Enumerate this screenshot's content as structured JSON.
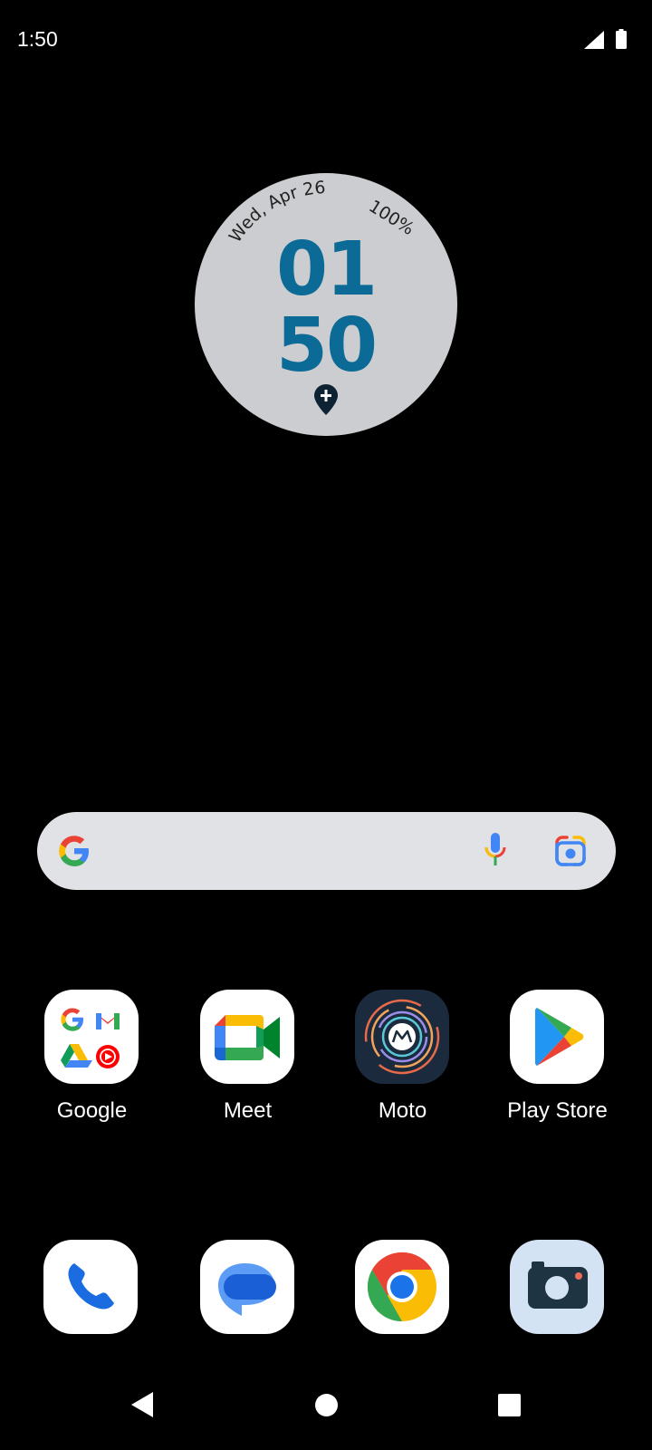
{
  "status_bar": {
    "time": "1:50",
    "icons": [
      "signal-icon",
      "battery-icon"
    ]
  },
  "clock_widget": {
    "date": "Wed, Apr 26",
    "battery": "100%",
    "hours": "01",
    "minutes": "50",
    "accent_color": "#0b6a96",
    "icon": "location-add-icon"
  },
  "search_bar": {
    "icons": [
      "google-g-icon",
      "mic-icon",
      "lens-icon"
    ]
  },
  "apps": [
    {
      "label": "Google",
      "icon": "google-folder-icon"
    },
    {
      "label": "Meet",
      "icon": "meet-icon"
    },
    {
      "label": "Moto",
      "icon": "moto-icon"
    },
    {
      "label": "Play Store",
      "icon": "play-store-icon"
    }
  ],
  "dock": [
    {
      "icon": "phone-icon"
    },
    {
      "icon": "messages-icon"
    },
    {
      "icon": "chrome-icon"
    },
    {
      "icon": "camera-icon"
    }
  ],
  "nav_bar": {
    "icons": [
      "back-icon",
      "home-icon",
      "recents-icon"
    ]
  }
}
